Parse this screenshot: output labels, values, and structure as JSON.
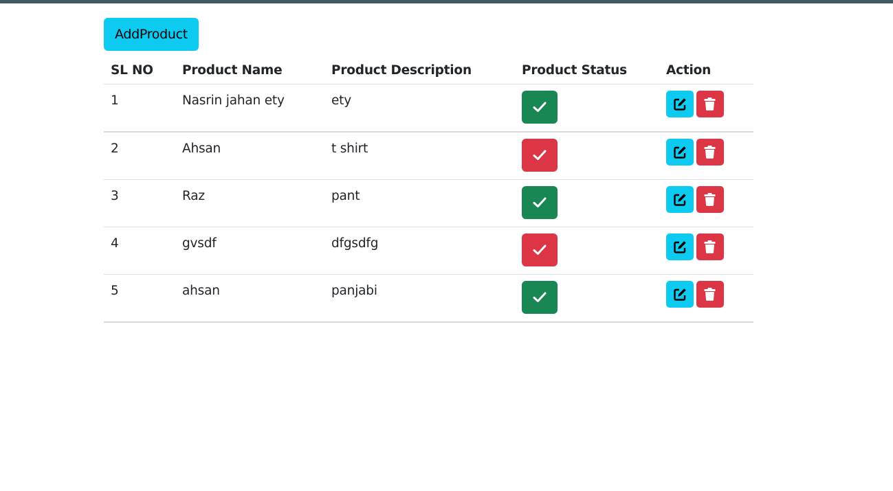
{
  "toolbar": {
    "add_label": "AddProduct",
    "add_color": "#0dcaf0"
  },
  "table": {
    "headers": {
      "sl": "SL NO",
      "name": "Product Name",
      "description": "Product Description",
      "status": "Product Status",
      "action": "Action"
    },
    "rows": [
      {
        "sl": "1",
        "name": "Nasrin jahan ety",
        "description": "ety",
        "status": "active",
        "status_color": "#198754"
      },
      {
        "sl": "2",
        "name": "Ahsan",
        "description": "t shirt",
        "status": "inactive",
        "status_color": "#dc3545"
      },
      {
        "sl": "3",
        "name": "Raz",
        "description": "pant",
        "status": "active",
        "status_color": "#198754"
      },
      {
        "sl": "4",
        "name": "gvsdf",
        "description": "dfgsdfg",
        "status": "inactive",
        "status_color": "#dc3545"
      },
      {
        "sl": "5",
        "name": "ahsan",
        "description": "panjabi",
        "status": "active",
        "status_color": "#198754"
      }
    ]
  },
  "icons": {
    "status": "check-icon",
    "edit": "edit-icon",
    "delete": "trash-icon"
  },
  "colors": {
    "top_bar": "#435a64",
    "active": "#198754",
    "inactive": "#dc3545",
    "edit": "#0dcaf0",
    "delete": "#dc3545"
  }
}
